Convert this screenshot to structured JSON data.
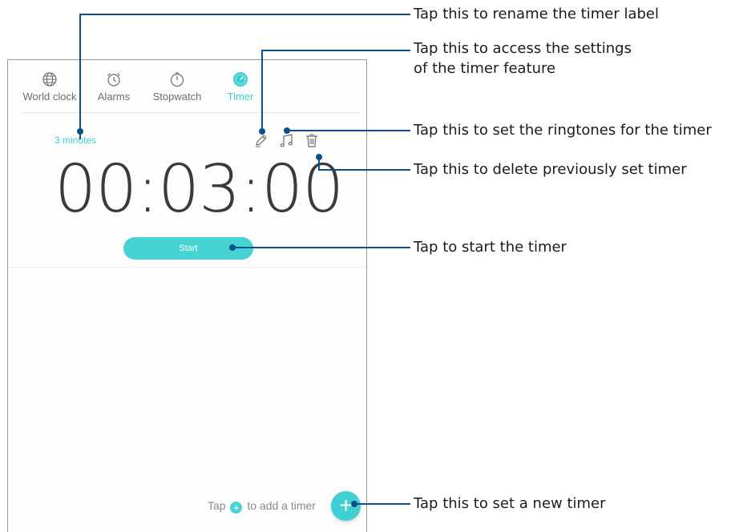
{
  "tabs": [
    {
      "label": "World clock",
      "icon": "globe-icon",
      "active": false
    },
    {
      "label": "Alarms",
      "icon": "alarm-clock-icon",
      "active": false
    },
    {
      "label": "Stopwatch",
      "icon": "stopwatch-icon",
      "active": false
    },
    {
      "label": "Timer",
      "icon": "timer-icon",
      "active": true
    }
  ],
  "timer": {
    "label": "3 minutes",
    "time": "00:03:00",
    "start_label": "Start"
  },
  "toolbar": {
    "rename_icon": "pencil-icon",
    "ringtone_icon": "music-note-icon",
    "delete_icon": "trash-icon"
  },
  "empty_hint": {
    "prefix": "Tap",
    "suffix": "to add a timer"
  },
  "fab": {
    "label": "+"
  },
  "callouts": {
    "rename": "Tap this to rename the timer label",
    "settings_line1": "Tap this to access the settings",
    "settings_line2": "of the timer feature",
    "ringtones": "Tap this to set the ringtones for the timer",
    "delete": "Tap this to delete previously set timer",
    "start": "Tap to start the timer",
    "new_timer": "Tap this to set a new timer"
  },
  "colors": {
    "accent": "#3ccfd2",
    "callout_line": "#0d4f8b",
    "text_dark": "#3a3a3a",
    "text_muted": "#6d6d6d"
  }
}
